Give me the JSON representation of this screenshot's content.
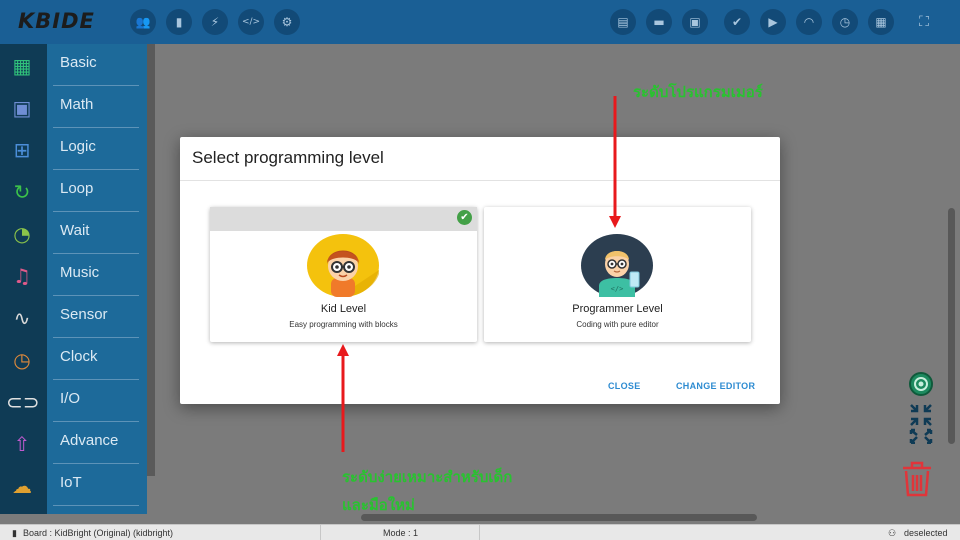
{
  "app": {
    "logo": "KBIDE"
  },
  "topbar": {
    "left_buttons": [
      {
        "name": "users-icon",
        "glyph": "👥"
      },
      {
        "name": "board-icon",
        "glyph": "▮"
      },
      {
        "name": "plug-icon",
        "glyph": "⚡"
      },
      {
        "name": "code-icon",
        "glyph": "</>"
      },
      {
        "name": "gear-icon",
        "glyph": "⚙"
      }
    ],
    "right_buttons": [
      {
        "name": "new-file-icon",
        "glyph": "▤"
      },
      {
        "name": "open-folder-icon",
        "glyph": "▬"
      },
      {
        "name": "save-icon",
        "glyph": "▣"
      },
      {
        "name": "check-icon",
        "glyph": "✔"
      },
      {
        "name": "play-icon",
        "glyph": "▶"
      },
      {
        "name": "wifi-icon",
        "glyph": "◠"
      },
      {
        "name": "timer-icon",
        "glyph": "◷"
      },
      {
        "name": "qrcode-icon",
        "glyph": "▦"
      },
      {
        "name": "fullscreen-icon",
        "glyph": "⛶"
      }
    ]
  },
  "sidebar": {
    "items": [
      {
        "label": "Basic",
        "icon": "grid-icon",
        "glyph": "▦",
        "color": "#30c07a"
      },
      {
        "label": "Math",
        "icon": "calculator-icon",
        "glyph": "▣",
        "color": "#6f8ed4"
      },
      {
        "label": "Logic",
        "icon": "hierarchy-icon",
        "glyph": "⊞",
        "color": "#4b8ed9"
      },
      {
        "label": "Loop",
        "icon": "loop-icon",
        "glyph": "↻",
        "color": "#3cc24a"
      },
      {
        "label": "Wait",
        "icon": "stopwatch-icon",
        "glyph": "◔",
        "color": "#8bc34a"
      },
      {
        "label": "Music",
        "icon": "music-icon",
        "glyph": "♫",
        "color": "#e05a8a"
      },
      {
        "label": "Sensor",
        "icon": "pulse-icon",
        "glyph": "∿",
        "color": "#d9d9d9"
      },
      {
        "label": "Clock",
        "icon": "clock-icon",
        "glyph": "◷",
        "color": "#e08a3a"
      },
      {
        "label": "I/O",
        "icon": "toggle-icon",
        "glyph": "⊂⊃",
        "color": "#e0e0e0"
      },
      {
        "label": "Advance",
        "icon": "upload-circle-icon",
        "glyph": "⇧",
        "color": "#c05acf"
      },
      {
        "label": "IoT",
        "icon": "cloud-icon",
        "glyph": "☁",
        "color": "#e0a030"
      }
    ]
  },
  "dialog": {
    "title": "Select programming level",
    "cards": [
      {
        "title": "Kid Level",
        "subtitle": "Easy programming with blocks",
        "selected": true
      },
      {
        "title": "Programmer Level",
        "subtitle": "Coding with pure editor",
        "selected": false
      }
    ],
    "close_label": "CLOSE",
    "change_label": "CHANGE EDITOR"
  },
  "annotations": {
    "top": "ระดับโปรแกรมเมอร์",
    "bottom_line1": "ระดับง่ายเหมาะสำหรับเด็ก",
    "bottom_line2": "และมือใหม่"
  },
  "statusbar": {
    "board": "Board : KidBright (Original) (kidbright)",
    "mode": "Mode : 1",
    "selection": "deselected"
  },
  "colors": {
    "topbar": "#1a5f95",
    "sidebar": "#1d6a9a",
    "accent_button_text": "#2d8bd1",
    "annotation": "#29c230",
    "arrow": "#e8191c"
  }
}
